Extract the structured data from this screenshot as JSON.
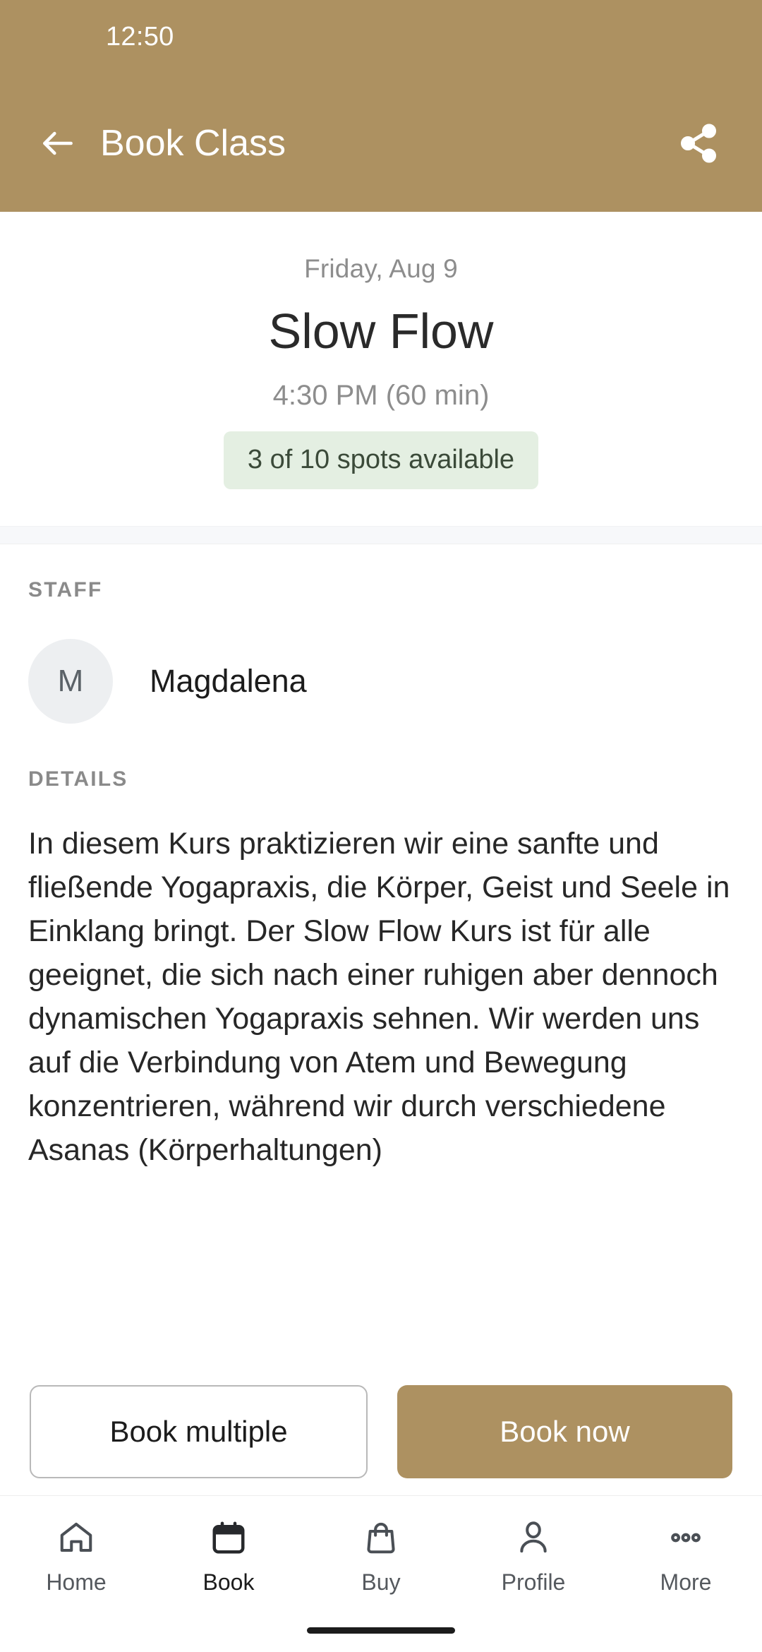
{
  "theme": {
    "brand": "#AD9161",
    "badge_bg": "#E4EFE2",
    "badge_text": "#3b4a39",
    "avatar_bg": "#EDEFF1",
    "separator": "#F7F8FA"
  },
  "status_bar": {
    "time": "12:50"
  },
  "app_bar": {
    "title": "Book Class",
    "back_icon": "arrow-left-icon",
    "share_icon": "share-icon"
  },
  "class_header": {
    "date": "Friday, Aug 9",
    "name": "Slow Flow",
    "time": "4:30 PM (60 min)",
    "spots": "3 of 10 spots available"
  },
  "staff_section": {
    "label": "STAFF",
    "members": [
      {
        "initial": "M",
        "name": "Magdalena"
      }
    ]
  },
  "details_section": {
    "label": "DETAILS",
    "text": "In diesem Kurs praktizieren wir eine sanfte und fließende Yogapraxis, die Körper, Geist und Seele in Einklang bringt. Der Slow Flow Kurs ist für alle geeignet, die sich nach einer ruhigen aber dennoch dynamischen Yogapraxis sehnen. Wir werden uns auf die Verbindung von Atem und Bewegung konzentrieren, während wir durch verschiedene Asanas (Körperhaltungen)"
  },
  "actions": {
    "secondary_label": "Book multiple",
    "primary_label": "Book now"
  },
  "bottom_nav": {
    "items": [
      {
        "label": "Home",
        "icon": "home-icon",
        "active": false
      },
      {
        "label": "Book",
        "icon": "calendar-icon",
        "active": true
      },
      {
        "label": "Buy",
        "icon": "bag-icon",
        "active": false
      },
      {
        "label": "Profile",
        "icon": "person-icon",
        "active": false
      },
      {
        "label": "More",
        "icon": "ellipsis-icon",
        "active": false
      }
    ]
  }
}
